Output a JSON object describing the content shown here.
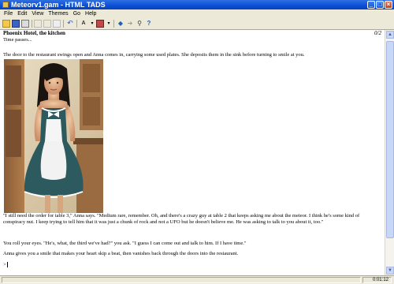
{
  "window": {
    "title": "Meteorv1.gam - HTML TADS"
  },
  "menu": [
    "File",
    "Edit",
    "View",
    "Themes",
    "Go",
    "Help"
  ],
  "toolbar_icons": [
    "open-icon",
    "save-icon",
    "print-icon",
    "cut-icon",
    "copy-icon",
    "paste-icon",
    "undo-icon",
    "font-icon",
    "theme-icon",
    "back-icon",
    "forward-icon",
    "find-icon",
    "help-icon"
  ],
  "statusline": {
    "location": "Phoenix Hotel, the kitchen",
    "score": "0/2"
  },
  "transcript": {
    "line1": "Time passes...",
    "line2": "The door to the restaurant swings open and Anna comes in, carrying some used plates. She deposits them in the sink before turning to smile at you.",
    "line3": "\"I still need the order for table 3,\" Anna says. \"Medium rare, remember. Oh, and there's a crazy guy at table 2 that keeps asking me about the meteor. I think he's some kind of conspiracy nut. I keep trying to tell him that it was just a chunk of rock and not a UFO but he doesn't believe me. He was asking to talk to you about it, too.\"",
    "line4": "You roll your eyes. \"He's, what, the third we've had?\" you ask. \"I guess I can come out and talk to him. If I have time.\"",
    "line5": "Anna gives you a smile that makes your heart skip a beat, then vanishes back through the doors into the restaurant.",
    "prompt": ">"
  },
  "statusbar": {
    "timer": "0:01:12"
  },
  "colors": {
    "title_blue": "#0a50d8",
    "dress_teal": "#2d5a5e",
    "page_white": "#ffffff"
  }
}
